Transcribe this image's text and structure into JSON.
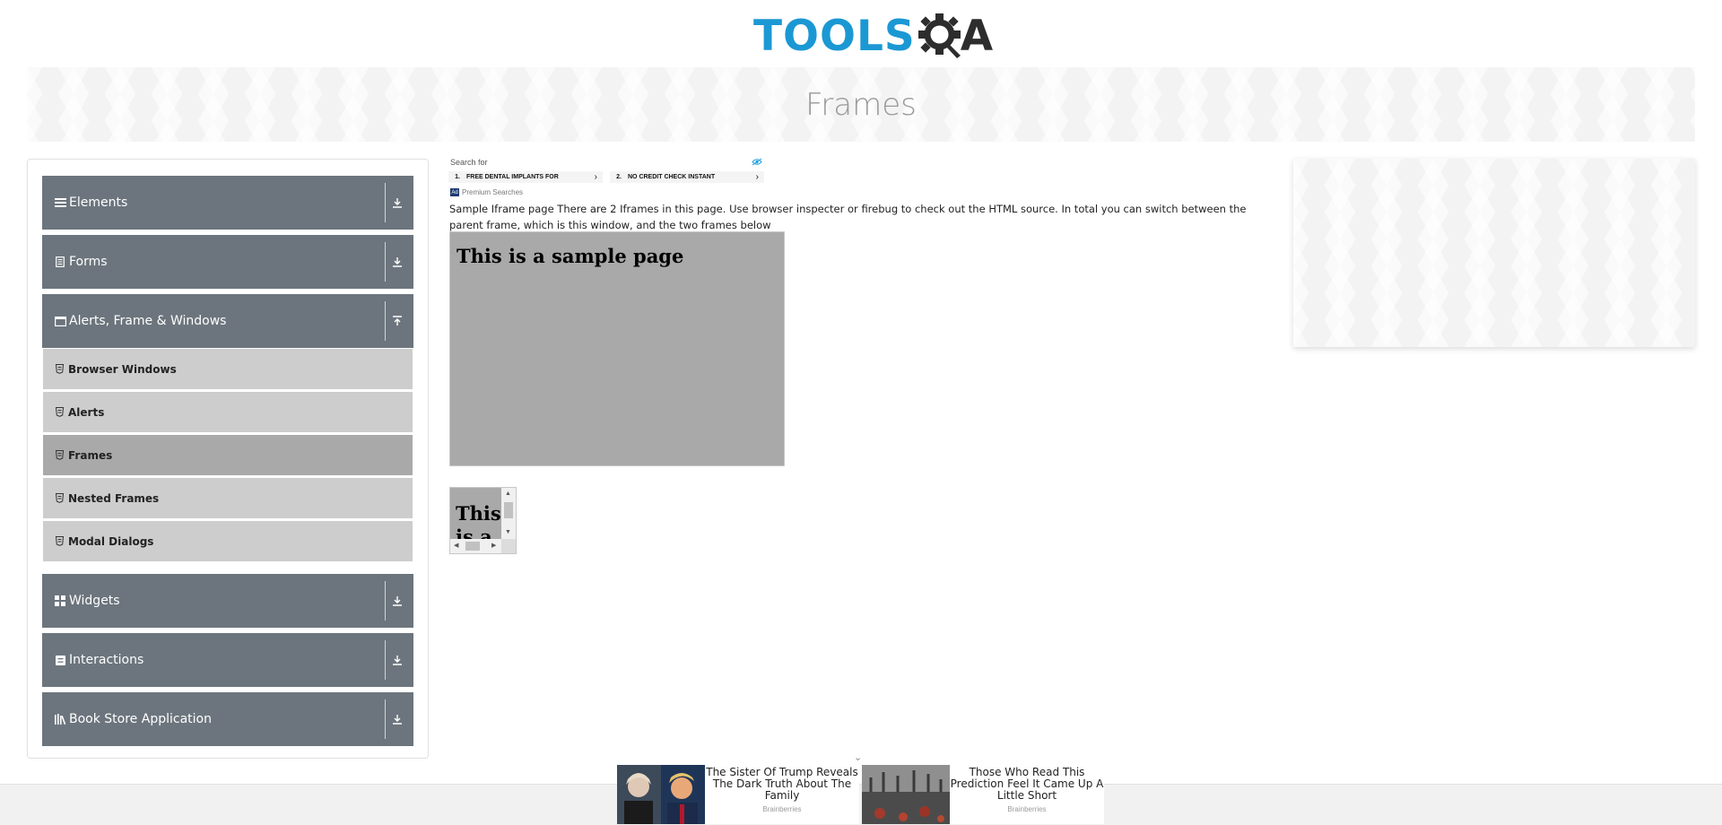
{
  "header": {
    "logo_tools": "TOOLS",
    "logo_a": "A",
    "page_title": "Frames"
  },
  "sidebar": {
    "groups": [
      {
        "label": "Elements",
        "icon": "menu-icon",
        "arrow": "download-arrow-icon"
      },
      {
        "label": "Forms",
        "icon": "form-icon",
        "arrow": "download-arrow-icon"
      },
      {
        "label": "Alerts, Frame & Windows",
        "icon": "window-icon",
        "arrow": "upload-arrow-icon"
      },
      {
        "label": "Widgets",
        "icon": "grid-icon",
        "arrow": "download-arrow-icon"
      },
      {
        "label": "Interactions",
        "icon": "interaction-icon",
        "arrow": "download-arrow-icon"
      },
      {
        "label": "Book Store Application",
        "icon": "library-icon",
        "arrow": "download-arrow-icon"
      }
    ],
    "items": [
      {
        "label": "Browser Windows",
        "active": false
      },
      {
        "label": "Alerts",
        "active": false
      },
      {
        "label": "Frames",
        "active": true
      },
      {
        "label": "Nested Frames",
        "active": false
      },
      {
        "label": "Modal Dialogs",
        "active": false
      }
    ]
  },
  "ad": {
    "search_for": "Search for",
    "row1_num": "1.",
    "row1_text": "FREE DENTAL IMPLANTS FOR",
    "row2_num": "2.",
    "row2_text": "NO CREDIT CHECK INSTANT",
    "badge": "Ad",
    "footer": "Premium Searches"
  },
  "main": {
    "description": "Sample Iframe page There are 2 Iframes in this page. Use browser inspecter or firebug to check out the HTML source. In total you can switch between the parent frame, which is this window, and the two frames below",
    "frame1_heading": "This is a sample page",
    "frame2_heading": "This is a sample page"
  },
  "footer_ads": [
    {
      "headline": "The Sister Of Trump Reveals The Dark Truth About The Family",
      "source": "Brainberries"
    },
    {
      "headline": "Those Who Read This Prediction Feel It Came Up A Little Short",
      "source": "Brainberries"
    }
  ],
  "colors": {
    "logo_blue": "#1b98d4",
    "sidebar_group": "#6c757d",
    "sidebar_item": "#cdcdcd",
    "sidebar_item_active": "#a9a9a9",
    "frame_bg": "#a9a9a9"
  }
}
